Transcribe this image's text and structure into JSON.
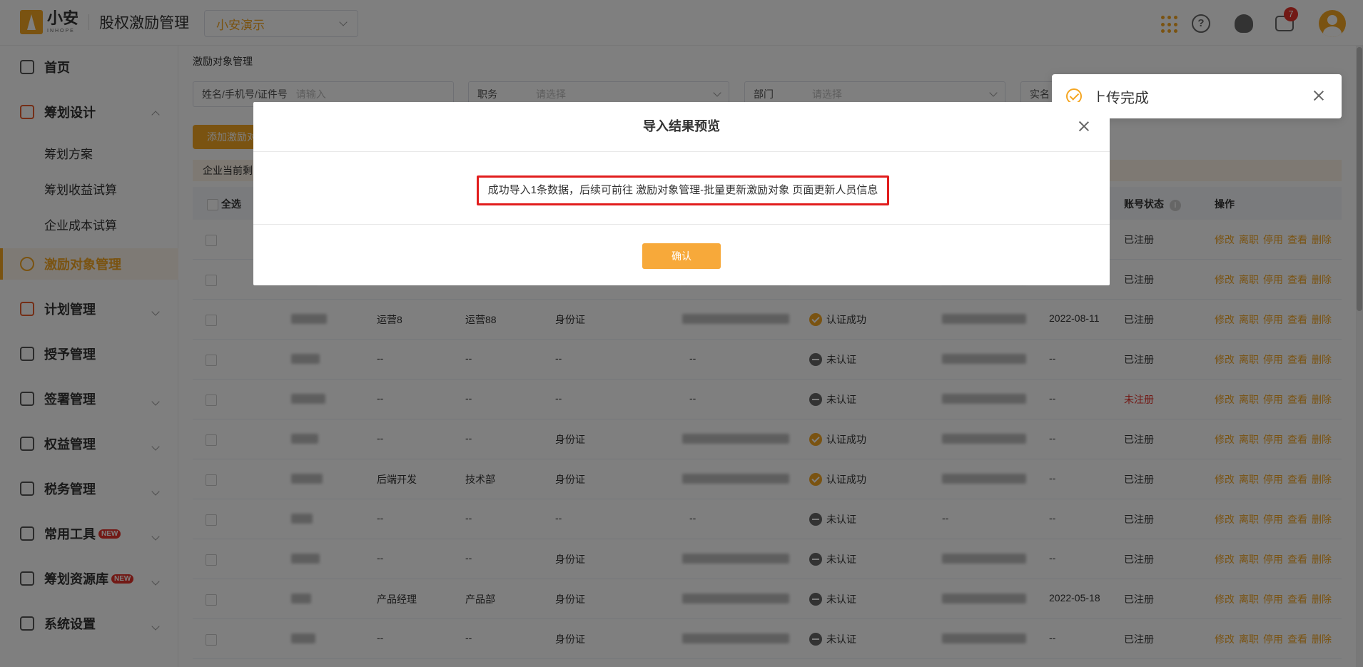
{
  "header": {
    "logo_cn": "小安",
    "logo_en": "INHOPE",
    "app_title": "股权激励管理",
    "company": "小安演示",
    "message_count": "7"
  },
  "sidebar": {
    "items": [
      {
        "label": "首页"
      },
      {
        "label": "筹划设计"
      },
      {
        "label": "筹划方案"
      },
      {
        "label": "筹划收益试算"
      },
      {
        "label": "企业成本试算"
      },
      {
        "label": "激励对象管理"
      },
      {
        "label": "计划管理"
      },
      {
        "label": "授予管理"
      },
      {
        "label": "签署管理"
      },
      {
        "label": "权益管理"
      },
      {
        "label": "税务管理"
      },
      {
        "label": "常用工具",
        "tag": "NEW"
      },
      {
        "label": "筹划资源库",
        "tag": "NEW"
      },
      {
        "label": "系统设置"
      }
    ]
  },
  "main": {
    "breadcrumb": "激励对象管理",
    "filters": [
      {
        "label": "姓名/手机号/证件号",
        "placeholder": "请输入"
      },
      {
        "label": "职务",
        "placeholder": "请选择"
      },
      {
        "label": "部门",
        "placeholder": "请选择"
      },
      {
        "label": "实名"
      }
    ],
    "add_button": "添加激励对象",
    "notice": "企业当前剩",
    "table": {
      "headers": {
        "select_all": "全选",
        "account_status": "账号状态",
        "actions": "操作"
      },
      "action_labels": [
        "修改",
        "离职",
        "停用",
        "查看",
        "删除"
      ],
      "rows": [
        {
          "title": "",
          "dept": "",
          "id_type": "",
          "id_no": "",
          "auth": "",
          "date": "",
          "account": "已注册",
          "red": false
        },
        {
          "title": "",
          "dept": "",
          "id_type": "",
          "id_no": "",
          "auth": "",
          "date": "",
          "account": "已注册",
          "red": false
        },
        {
          "title": "运营8",
          "dept": "运营88",
          "id_type": "身份证",
          "id_no": "",
          "auth": "认证成功",
          "date": "2022-08-11",
          "account": "已注册",
          "red": false
        },
        {
          "title": "--",
          "dept": "--",
          "id_type": "--",
          "id_no": "--",
          "auth": "未认证",
          "date": "--",
          "account": "已注册",
          "red": false
        },
        {
          "title": "--",
          "dept": "--",
          "id_type": "--",
          "id_no": "--",
          "auth": "未认证",
          "date": "--",
          "account": "未注册",
          "red": true
        },
        {
          "title": "--",
          "dept": "--",
          "id_type": "身份证",
          "id_no": "",
          "auth": "认证成功",
          "date": "--",
          "account": "已注册",
          "red": false
        },
        {
          "title": "后端开发",
          "dept": "技术部",
          "id_type": "身份证",
          "id_no": "",
          "auth": "认证成功",
          "date": "--",
          "account": "已注册",
          "red": false
        },
        {
          "title": "--",
          "dept": "--",
          "id_type": "--",
          "id_no": "--",
          "auth": "未认证",
          "phone": "--",
          "date": "--",
          "account": "已注册",
          "red": false
        },
        {
          "title": "--",
          "dept": "--",
          "id_type": "身份证",
          "id_no": "",
          "auth": "未认证",
          "date": "--",
          "account": "已注册",
          "red": false
        },
        {
          "title": "产品经理",
          "dept": "产品部",
          "id_type": "身份证",
          "id_no": "",
          "auth": "未认证",
          "date": "2022-05-18",
          "account": "已注册",
          "red": false
        },
        {
          "title": "--",
          "dept": "--",
          "id_type": "身份证",
          "id_no": "",
          "auth": "未认证",
          "date": "--",
          "account": "已注册",
          "red": false
        }
      ]
    }
  },
  "toast": {
    "text": "上传完成"
  },
  "modal": {
    "title": "导入结果预览",
    "message": "成功导入1条数据，后续可前往 激励对象管理-批量更新激励对象 页面更新人员信息",
    "confirm": "确认"
  },
  "colors": {
    "accent": "#f5a623",
    "danger": "#e5332b",
    "highlight": "#e11d1d"
  }
}
